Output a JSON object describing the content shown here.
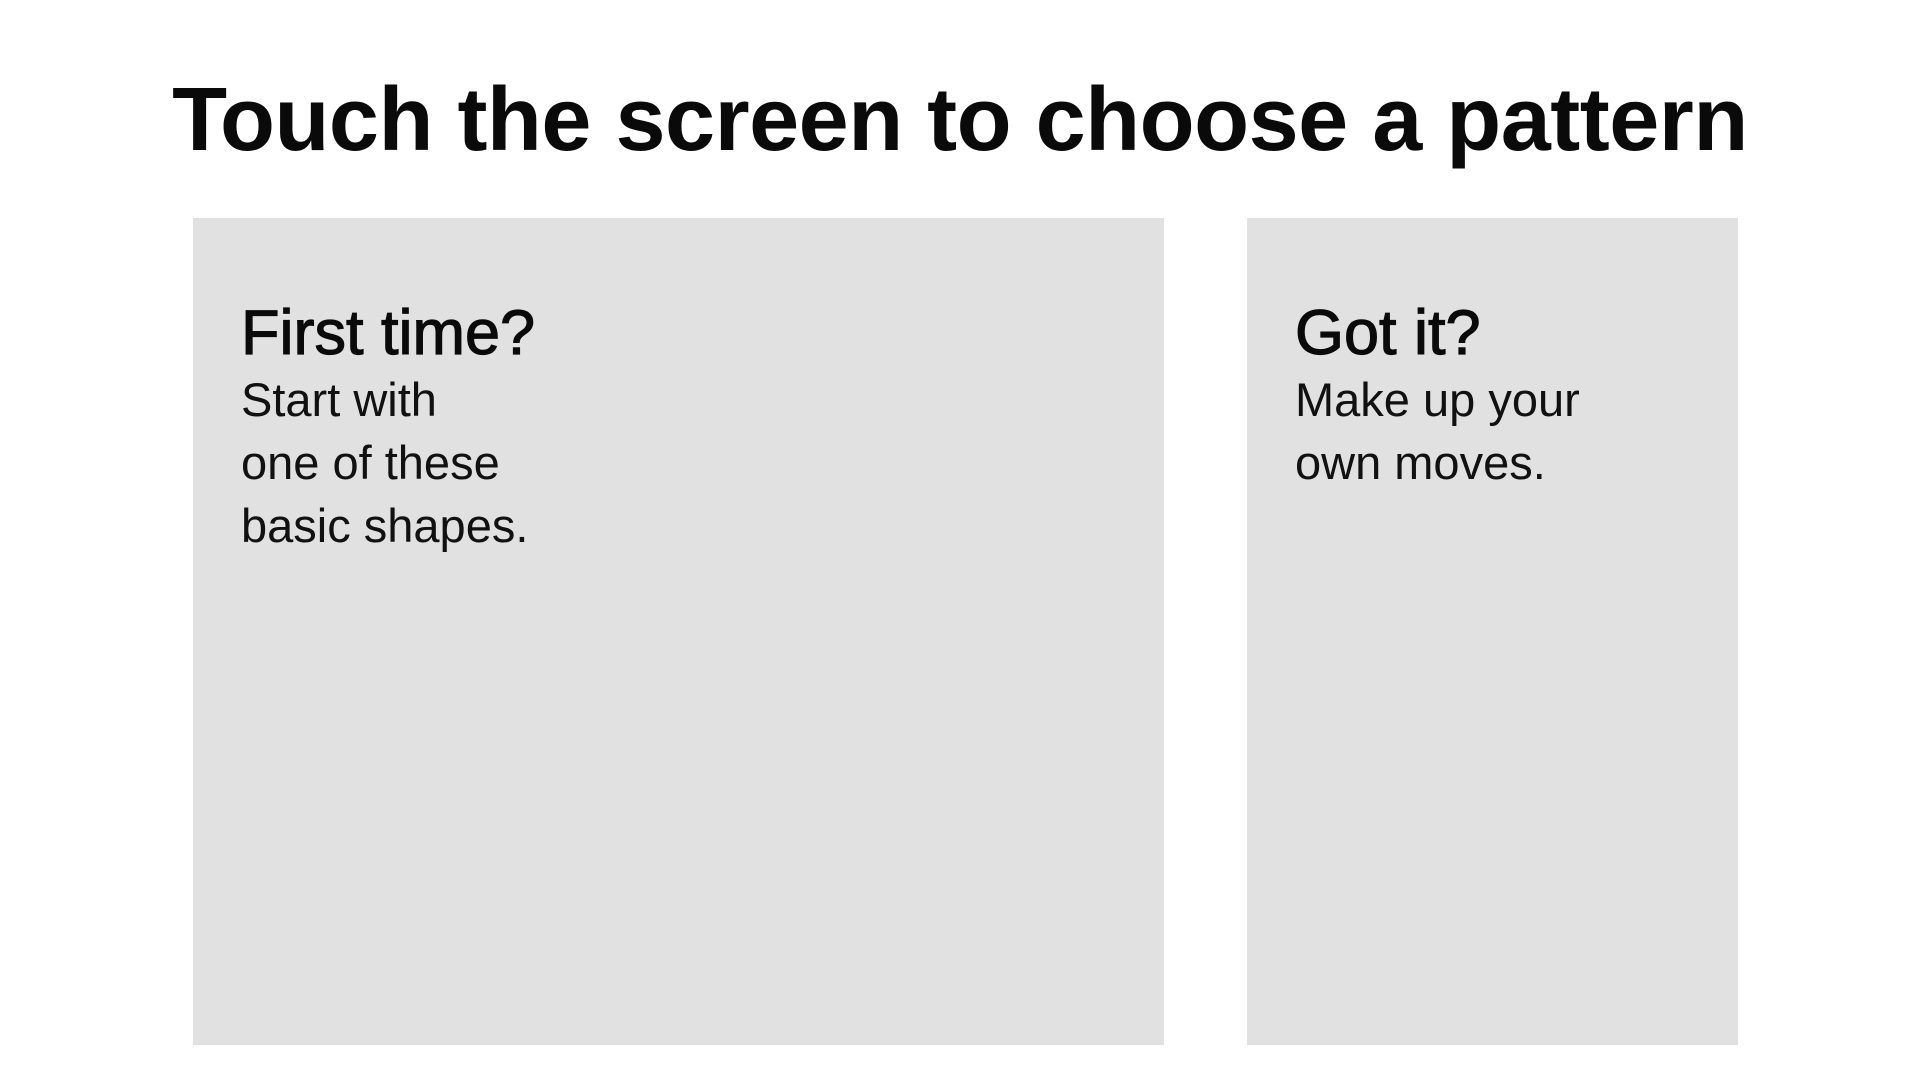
{
  "title": "Touch the screen to choose a pattern",
  "panels": {
    "first_time": {
      "heading": "First time?",
      "lines": [
        "Start with",
        "one of these",
        "basic shapes."
      ]
    },
    "got_it": {
      "heading": "Got it?",
      "lines": [
        "Make up your",
        "own moves."
      ]
    }
  },
  "colors": {
    "background": "#ffffff",
    "panel": "#e1e1e1",
    "text": "#0a0a0a"
  }
}
